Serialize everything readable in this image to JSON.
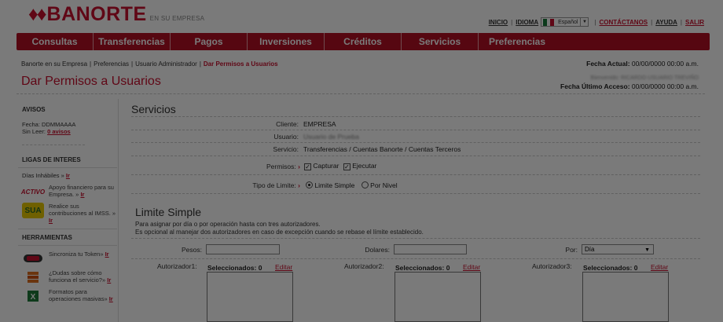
{
  "brand": {
    "mark": "♦♦",
    "name": "BANORTE",
    "tagline": "EN SU EMPRESA"
  },
  "toplinks": {
    "inicio": "INICIO",
    "idioma": "IDIOMA",
    "language": "Español",
    "contact": "CONTÁCTANOS",
    "help": "AYUDA",
    "exit": "SALIR"
  },
  "nav": [
    "Consultas",
    "Transferencias",
    "Pagos",
    "Inversiones",
    "Créditos",
    "Servicios",
    "Preferencias"
  ],
  "breadcrumb": [
    "Banorte en su Empresa",
    "Preferencias",
    "Usuario Administrador",
    "Dar Permisos a Usuarios"
  ],
  "fecha_actual": {
    "label": "Fecha Actual:",
    "value": "00/00/0000 00:00 a.m."
  },
  "page_title": "Dar Permisos a Usuarios",
  "user_greeting": "Bienvenido: RICARDO USUARIO TREVIÑO",
  "fecha_ultimo": {
    "label": "Fecha Último Acceso:",
    "value": "00/00/0000 00:00 a.m."
  },
  "sidebar": {
    "avisos": {
      "title": "AVISOS",
      "fecha": "Fecha: DDMMAAAA",
      "sin_leer_label": "Sin Leer:",
      "sin_leer_link": "0 avisos"
    },
    "ligas": {
      "title": "LIGAS DE INTERES",
      "dias": "Días Inhábiles »",
      "dias_link": "Ir",
      "items": [
        {
          "icon": "ACTIVO",
          "text": "Apoyo financiero para su Empresa. »",
          "link": "Ir"
        },
        {
          "icon": "SUA",
          "text": "Realice sus contribuciones al IMSS. »",
          "link": "Ir"
        }
      ]
    },
    "herramientas": {
      "title": "HERRAMIENTAS",
      "items": [
        {
          "icon": "token-icon",
          "text": "Sincroniza tu Token»",
          "link": "Ir"
        },
        {
          "icon": "help-icon",
          "text": "¿Dudas sobre cómo funciona el servicio?»",
          "link": "Ir"
        },
        {
          "icon": "excel-icon",
          "text": "Formatos para operaciones masivas»",
          "link": "Ir"
        }
      ]
    }
  },
  "servicios": {
    "title": "Servicios",
    "cliente_label": "Cliente:",
    "cliente_value": "EMPRESA",
    "usuario_label": "Usuario:",
    "usuario_value": "Usuario de Prueba",
    "servicio_label": "Servicio:",
    "servicio_value": "Transferencias / Cuentas Banorte / Cuentas Terceros",
    "permisos_label": "Permisos:",
    "permisos": [
      {
        "label": "Capturar",
        "checked": true
      },
      {
        "label": "Ejecutar",
        "checked": true
      }
    ],
    "tipo_label": "Tipo de Limite:",
    "tipos": [
      {
        "label": "Limite Simple",
        "selected": true
      },
      {
        "label": "Por Nivel",
        "selected": false
      }
    ]
  },
  "limite": {
    "title": "Limite Simple",
    "desc1": "Para asignar por día o por operación hasta con tres autorizadores.",
    "desc2": "Es opcional al manejar dos autorizadores en caso de excepción cuando se rebase el límite establecido.",
    "pesos_label": "Pesos:",
    "dolares_label": "Dolares:",
    "por_label": "Por:",
    "por_value": "Día",
    "aut1": "Autorizador1:",
    "aut2": "Autorizador2:",
    "aut3": "Autorizador3:",
    "seleccionados": "Seleccionados: 0",
    "editar": "Editar"
  },
  "colors": {
    "brand_red": "#c8102e",
    "nav_red": "#b30f25"
  }
}
